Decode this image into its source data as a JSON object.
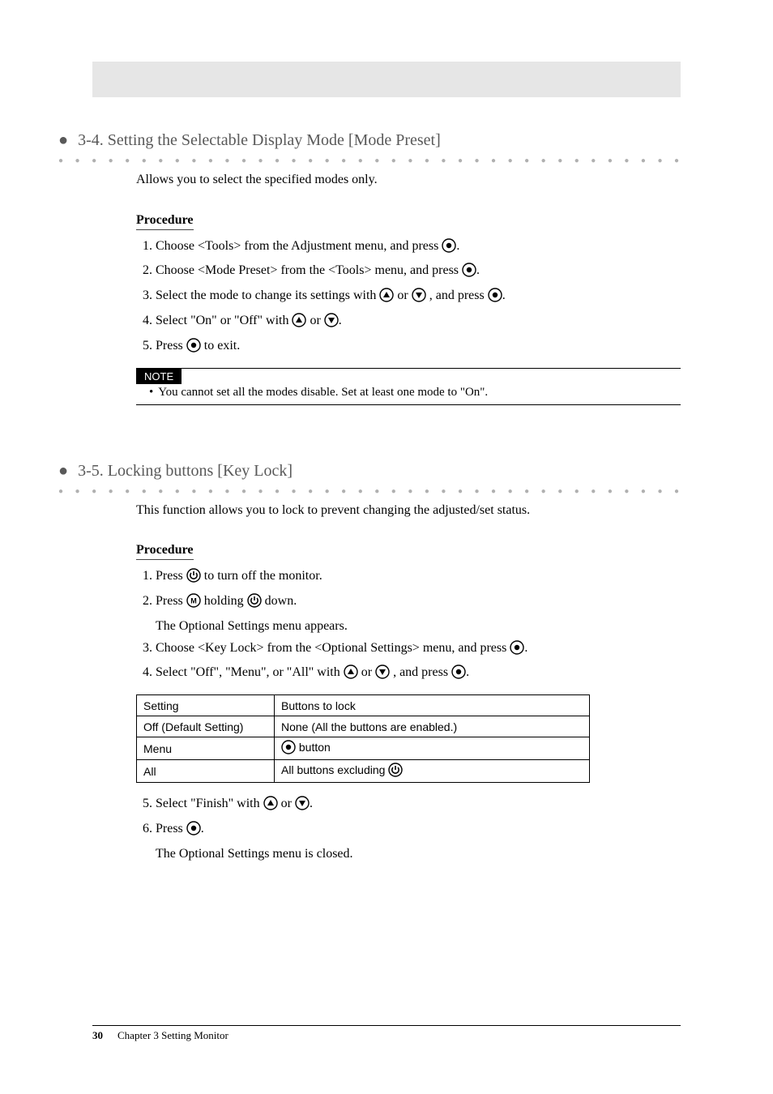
{
  "sections": [
    {
      "title": "3-4. Setting the Selectable Display Mode [Mode Preset]",
      "intro": "Allows you to select the specified modes only.",
      "proc_label": "Procedure",
      "steps": [
        {
          "pre": "Choose <Tools> from the Adjustment menu, and press ",
          "icon": "enter",
          "post": "."
        },
        {
          "pre": "Choose <Mode Preset> from the <Tools> menu, and press ",
          "icon": "enter",
          "post": "."
        },
        {
          "pre": "Select the mode to change its settings with ",
          "mid_or": true,
          "post_or": ", and press ",
          "icon_end": "enter",
          "post": "."
        },
        {
          "pre": "Select \"On\" or \"Off\" with ",
          "mid_or": true,
          "post": "."
        },
        {
          "pre": "Press ",
          "icon": "enter",
          "post": " to exit."
        }
      ],
      "note_label": "NOTE",
      "note_text": "You cannot set all the modes disable. Set at least one mode to \"On\"."
    },
    {
      "title": "3-5. Locking buttons [Key Lock]",
      "intro": "This function allows you to lock to prevent changing the adjusted/set status.",
      "proc_label": "Procedure",
      "steps_kl": {
        "s1a": "Press ",
        "s1b": " to turn off the monitor.",
        "s2a": "Press ",
        "s2b": " holding ",
        "s2c": " down.",
        "s2_sub": "The Optional Settings menu appears.",
        "s3a": "Choose <Key Lock> from the <Optional Settings> menu, and press ",
        "s4a": "Select \"Off\", \"Menu\", or \"All\" with ",
        "s4_or": " or ",
        "s4b": ", and press ",
        "s5a": "Select \"Finish\" with ",
        "s5_or": " or ",
        "s6a": "Press ",
        "s6_sub": "The Optional Settings menu is closed."
      },
      "table": {
        "h1": "Setting",
        "h2": "Buttons to lock",
        "rows": [
          {
            "setting": "Off (Default Setting)",
            "lock": "None (All the buttons are enabled.)"
          },
          {
            "setting": "Menu",
            "lock_pre": "",
            "lock_icon": "enter",
            "lock_post": " button"
          },
          {
            "setting": "All",
            "lock_pre": "All buttons excluding ",
            "lock_icon": "power",
            "lock_post": ""
          }
        ]
      }
    }
  ],
  "footer": {
    "page": "30",
    "chapter": "Chapter 3  Setting Monitor"
  },
  "or_word": " or ",
  "period": "."
}
